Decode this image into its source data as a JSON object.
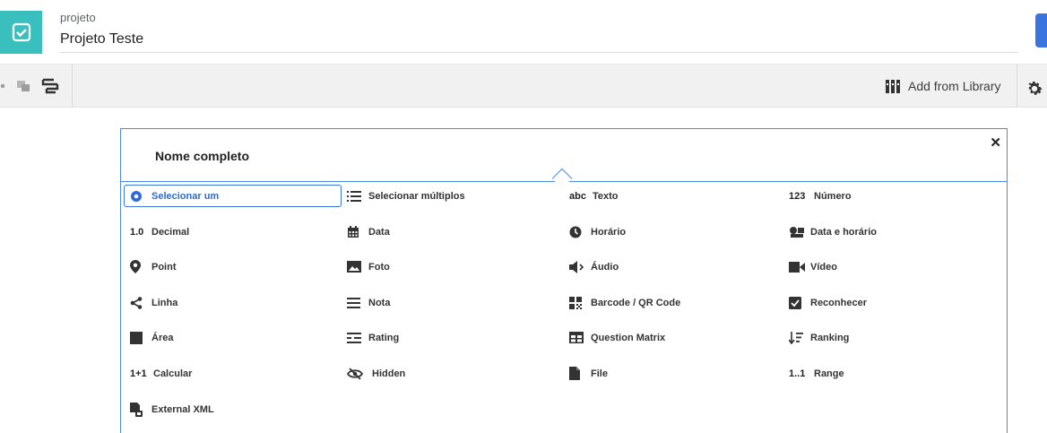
{
  "header": {
    "project_label": "projeto",
    "project_name": "Projeto Teste",
    "logo_color": "#39bfbd",
    "deploy_color": "#3a74de"
  },
  "toolbar": {
    "library_label": "Add from Library",
    "icons": [
      "group-icon",
      "layers-icon",
      "branching-icon",
      "library-icon",
      "gear-icon"
    ]
  },
  "question": {
    "title": "Nome completo",
    "close": "✕"
  },
  "types": [
    {
      "label": "Selecionar um",
      "icon": "radio-icon",
      "glyph": "",
      "selected": true
    },
    {
      "label": "Selecionar múltiplos",
      "icon": "list-icon",
      "glyph": ""
    },
    {
      "label": "Texto",
      "icon": "text-icon",
      "glyph": "abc"
    },
    {
      "label": "Número",
      "icon": "number-icon",
      "glyph": "123"
    },
    {
      "label": "Decimal",
      "icon": "decimal-icon",
      "glyph": "1.0"
    },
    {
      "label": "Data",
      "icon": "calendar-icon",
      "glyph": ""
    },
    {
      "label": "Horário",
      "icon": "clock-icon",
      "glyph": ""
    },
    {
      "label": "Data e horário",
      "icon": "datetime-icon",
      "glyph": ""
    },
    {
      "label": "Point",
      "icon": "map-pin-icon",
      "glyph": ""
    },
    {
      "label": "Foto",
      "icon": "photo-icon",
      "glyph": ""
    },
    {
      "label": "Áudio",
      "icon": "speaker-icon",
      "glyph": ""
    },
    {
      "label": "Vídeo",
      "icon": "video-icon",
      "glyph": ""
    },
    {
      "label": "Linha",
      "icon": "share-icon",
      "glyph": ""
    },
    {
      "label": "Nota",
      "icon": "menu-icon",
      "glyph": ""
    },
    {
      "label": "Barcode / QR Code",
      "icon": "qrcode-icon",
      "glyph": ""
    },
    {
      "label": "Reconhecer",
      "icon": "checkbox-icon",
      "glyph": ""
    },
    {
      "label": "Área",
      "icon": "square-icon",
      "glyph": ""
    },
    {
      "label": "Rating",
      "icon": "rating-icon",
      "glyph": ""
    },
    {
      "label": "Question Matrix",
      "icon": "table-icon",
      "glyph": ""
    },
    {
      "label": "Ranking",
      "icon": "sort-icon",
      "glyph": ""
    },
    {
      "label": "Calcular",
      "icon": "calc-icon",
      "glyph": "1+1"
    },
    {
      "label": "Hidden",
      "icon": "eye-off-icon",
      "glyph": ""
    },
    {
      "label": "File",
      "icon": "file-icon",
      "glyph": ""
    },
    {
      "label": "Range",
      "icon": "range-icon",
      "glyph": "1..1"
    },
    {
      "label": "External XML",
      "icon": "xml-file-icon",
      "glyph": ""
    }
  ]
}
